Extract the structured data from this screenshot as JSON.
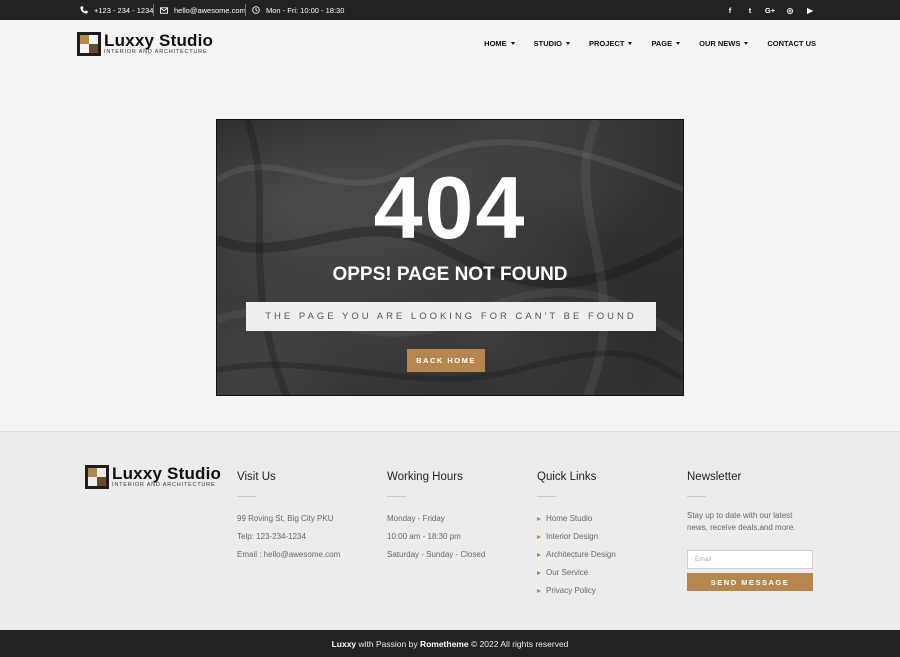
{
  "topbar": {
    "phone": "+123 - 234 - 1234",
    "email": "hello@awesome.com",
    "hours": "Mon - Fri: 10:00 - 18:30",
    "social": [
      {
        "icon": "facebook-icon",
        "glyph": "f"
      },
      {
        "icon": "twitter-icon",
        "glyph": "t"
      },
      {
        "icon": "google-plus-icon",
        "glyph": "G+"
      },
      {
        "icon": "instagram-icon",
        "glyph": "◎"
      },
      {
        "icon": "youtube-icon",
        "glyph": "▶"
      }
    ]
  },
  "brand": {
    "name": "Luxxy Studio",
    "tagline": "INTERIOR AND ARCHITECTURE"
  },
  "nav": {
    "items": [
      {
        "label": "HOME",
        "dropdown": true
      },
      {
        "label": "STUDIO",
        "dropdown": true
      },
      {
        "label": "PROJECT",
        "dropdown": true
      },
      {
        "label": "PAGE",
        "dropdown": true
      },
      {
        "label": "OUR NEWS",
        "dropdown": true
      },
      {
        "label": "CONTACT US",
        "dropdown": false
      }
    ]
  },
  "error": {
    "code": "404",
    "title": "OPPS! PAGE NOT FOUND",
    "message": "THE PAGE YOU ARE LOOKING FOR CAN'T BE FOUND",
    "button": "BACK HOME"
  },
  "footer": {
    "visit": {
      "heading": "Visit Us",
      "address": "99 Roving St, Big City PKU",
      "phone": "Telp: 123-234-1234",
      "email": "Email : hello@awesome.com"
    },
    "hours": {
      "heading": "Working Hours",
      "line1": "Monday - Friday",
      "line2": "10:00 am - 18:30 pm",
      "line3": "Saturday - Sunday - Closed"
    },
    "links": {
      "heading": "Quick Links",
      "items": [
        "Home Studio",
        "Interior Design",
        "Architecture Design",
        "Our Service",
        "Privacy Policy"
      ]
    },
    "newsletter": {
      "heading": "Newsletter",
      "text": "Stay up to date with our latest news, receive deals,and more.",
      "placeholder": "Email",
      "button": "SEND MESSAGE"
    }
  },
  "copyright": {
    "brand": "Luxxy",
    "middle": " with Passion by ",
    "author": "Rometheme",
    "tail": " © 2022 All rights reserved"
  },
  "colors": {
    "accent": "#b5874f",
    "dark": "#222222"
  }
}
